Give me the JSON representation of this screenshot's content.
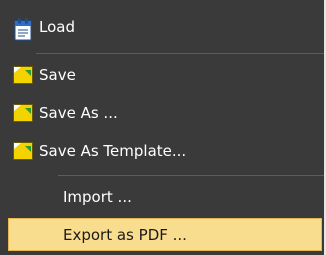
{
  "menu": {
    "items": [
      {
        "label": "Load",
        "icon": "load-icon"
      },
      {
        "label": "Save",
        "icon": "save-icon"
      },
      {
        "label": "Save As ...",
        "icon": "save-icon"
      },
      {
        "label": "Save As Template...",
        "icon": "save-icon"
      },
      {
        "label": "Import ...",
        "icon": ""
      },
      {
        "label": "Export as PDF ...",
        "icon": ""
      }
    ],
    "highlighted_item": "Export as PDF ...",
    "colors": {
      "background": "#3a3a3a",
      "text": "#ffffff",
      "highlight": "#f9dd8f",
      "highlight_border": "#e5b74e",
      "separator": "#5c5c5c",
      "save_icon_body": "#f3d400"
    }
  }
}
